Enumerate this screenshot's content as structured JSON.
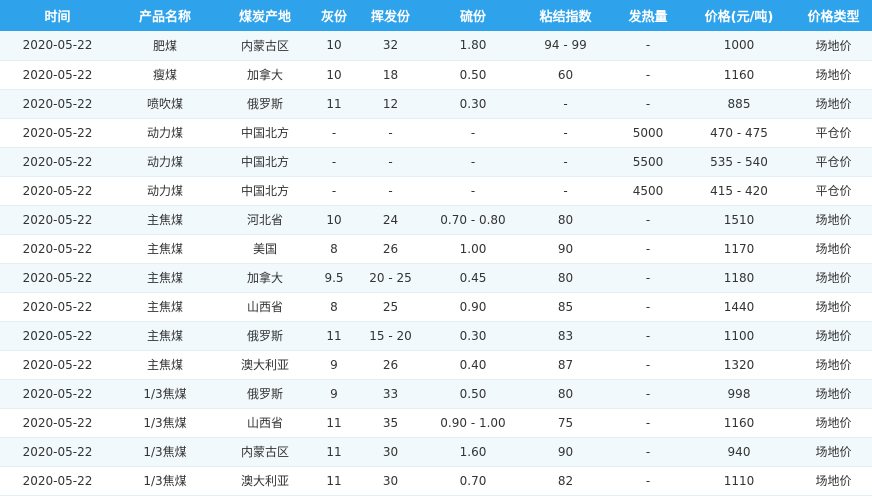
{
  "headers": [
    "时间",
    "产品名称",
    "煤炭产地",
    "灰份",
    "挥发份",
    "硫份",
    "粘结指数",
    "发热量",
    "价格(元/吨)",
    "价格类型"
  ],
  "rows": [
    [
      "2020-05-22",
      "肥煤",
      "内蒙古区",
      "10",
      "32",
      "1.80",
      "94 - 99",
      "-",
      "1000",
      "场地价"
    ],
    [
      "2020-05-22",
      "瘦煤",
      "加拿大",
      "10",
      "18",
      "0.50",
      "60",
      "-",
      "1160",
      "场地价"
    ],
    [
      "2020-05-22",
      "喷吹煤",
      "俄罗斯",
      "11",
      "12",
      "0.30",
      "-",
      "-",
      "885",
      "场地价"
    ],
    [
      "2020-05-22",
      "动力煤",
      "中国北方",
      "-",
      "-",
      "-",
      "-",
      "5000",
      "470 - 475",
      "平仓价"
    ],
    [
      "2020-05-22",
      "动力煤",
      "中国北方",
      "-",
      "-",
      "-",
      "-",
      "5500",
      "535 - 540",
      "平仓价"
    ],
    [
      "2020-05-22",
      "动力煤",
      "中国北方",
      "-",
      "-",
      "-",
      "-",
      "4500",
      "415 - 420",
      "平仓价"
    ],
    [
      "2020-05-22",
      "主焦煤",
      "河北省",
      "10",
      "24",
      "0.70 - 0.80",
      "80",
      "-",
      "1510",
      "场地价"
    ],
    [
      "2020-05-22",
      "主焦煤",
      "美国",
      "8",
      "26",
      "1.00",
      "90",
      "-",
      "1170",
      "场地价"
    ],
    [
      "2020-05-22",
      "主焦煤",
      "加拿大",
      "9.5",
      "20 - 25",
      "0.45",
      "80",
      "-",
      "1180",
      "场地价"
    ],
    [
      "2020-05-22",
      "主焦煤",
      "山西省",
      "8",
      "25",
      "0.90",
      "85",
      "-",
      "1440",
      "场地价"
    ],
    [
      "2020-05-22",
      "主焦煤",
      "俄罗斯",
      "11",
      "15 - 20",
      "0.30",
      "83",
      "-",
      "1100",
      "场地价"
    ],
    [
      "2020-05-22",
      "主焦煤",
      "澳大利亚",
      "9",
      "26",
      "0.40",
      "87",
      "-",
      "1320",
      "场地价"
    ],
    [
      "2020-05-22",
      "1/3焦煤",
      "俄罗斯",
      "9",
      "33",
      "0.50",
      "80",
      "-",
      "998",
      "场地价"
    ],
    [
      "2020-05-22",
      "1/3焦煤",
      "山西省",
      "11",
      "35",
      "0.90 - 1.00",
      "75",
      "-",
      "1160",
      "场地价"
    ],
    [
      "2020-05-22",
      "1/3焦煤",
      "内蒙古区",
      "11",
      "30",
      "1.60",
      "90",
      "-",
      "940",
      "场地价"
    ],
    [
      "2020-05-22",
      "1/3焦煤",
      "澳大利亚",
      "11",
      "30",
      "0.70",
      "82",
      "-",
      "1110",
      "场地价"
    ]
  ],
  "colors": {
    "header_bg": "#2ea3ec",
    "stripe_bg": "#f2f9fd",
    "text": "#333333"
  }
}
